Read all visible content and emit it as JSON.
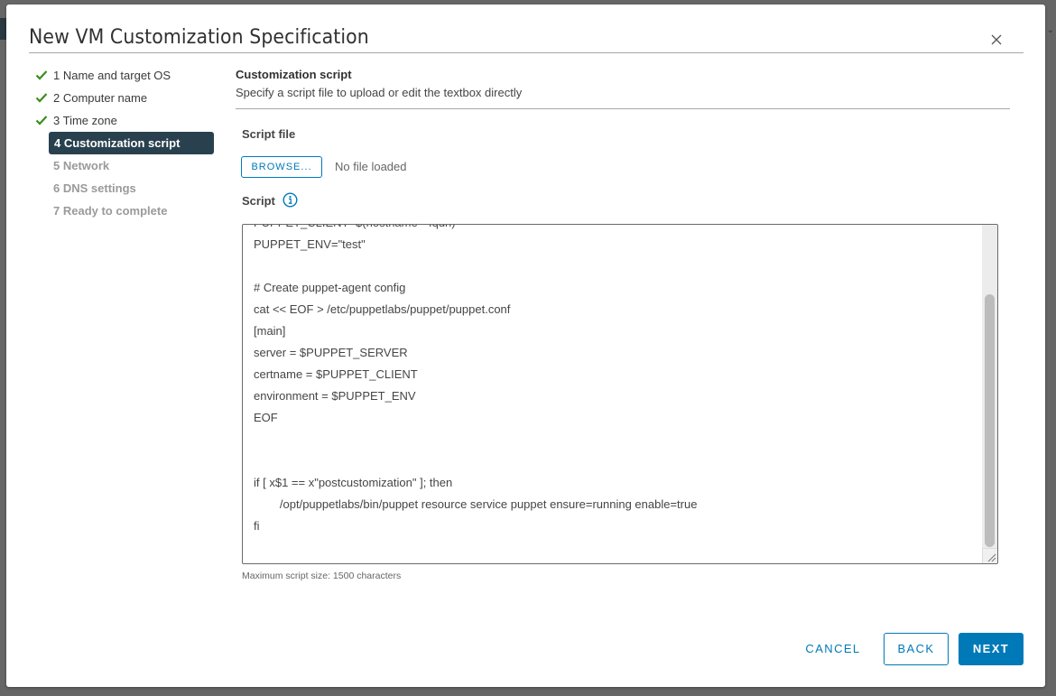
{
  "dialog": {
    "title": "New VM Customization Specification",
    "close_icon": "close-icon"
  },
  "wizard": {
    "steps": [
      {
        "label": "1 Name and target OS",
        "state": "done"
      },
      {
        "label": "2 Computer name",
        "state": "done"
      },
      {
        "label": "3 Time zone",
        "state": "done"
      },
      {
        "label": "4 Customization script",
        "state": "active"
      },
      {
        "label": "5 Network",
        "state": "pending"
      },
      {
        "label": "6 DNS settings",
        "state": "pending"
      },
      {
        "label": "7 Ready to complete",
        "state": "pending"
      }
    ]
  },
  "content": {
    "title": "Customization script",
    "subtitle": "Specify a script file to upload or edit the textbox directly",
    "script_file_label": "Script file",
    "browse_label": "BROWSE...",
    "file_status": "No file loaded",
    "script_label": "Script",
    "info_icon": "info-icon",
    "script_lines": [
      "PUPPET_CLIENT=$(hostname --fqdn)",
      "PUPPET_ENV=\"test\"",
      "",
      "# Create puppet-agent config",
      "cat << EOF > /etc/puppetlabs/puppet/puppet.conf",
      "[main]",
      "server = $PUPPET_SERVER",
      "certname = $PUPPET_CLIENT",
      "environment = $PUPPET_ENV",
      "EOF",
      "",
      "",
      "if [ x$1 == x\"postcustomization\" ]; then",
      "        /opt/puppetlabs/bin/puppet resource service puppet ensure=running enable=true",
      "fi",
      ""
    ],
    "hint": "Maximum script size: 1500 characters"
  },
  "footer": {
    "cancel_label": "CANCEL",
    "back_label": "BACK",
    "next_label": "NEXT"
  },
  "colors": {
    "accent": "#0079b8",
    "active_step_bg": "#29414e",
    "check_green": "#3c8d1d"
  }
}
